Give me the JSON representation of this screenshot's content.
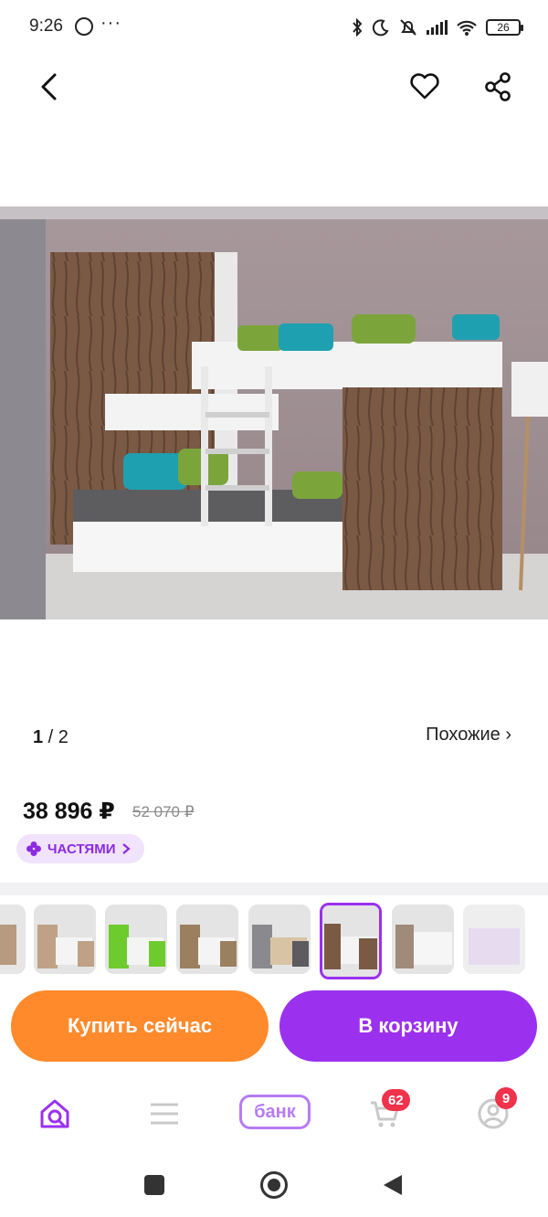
{
  "status_bar": {
    "time": "9:26",
    "dots": "···",
    "battery": "26"
  },
  "gallery": {
    "current": "1",
    "total": "2",
    "similar_label": "Похожие ›"
  },
  "product": {
    "price": "38 896 ₽",
    "old_price": "52 070 ₽",
    "installments_label": "ЧАСТЯМИ"
  },
  "actions": {
    "buy_now": "Купить сейчас",
    "add_to_cart": "В корзину"
  },
  "tabbar": {
    "bank_label": "банк",
    "cart_badge": "62",
    "profile_badge": "9"
  },
  "colors": {
    "accent": "#9b30ef",
    "buy": "#ff8a2c",
    "badge": "#f0324b"
  }
}
